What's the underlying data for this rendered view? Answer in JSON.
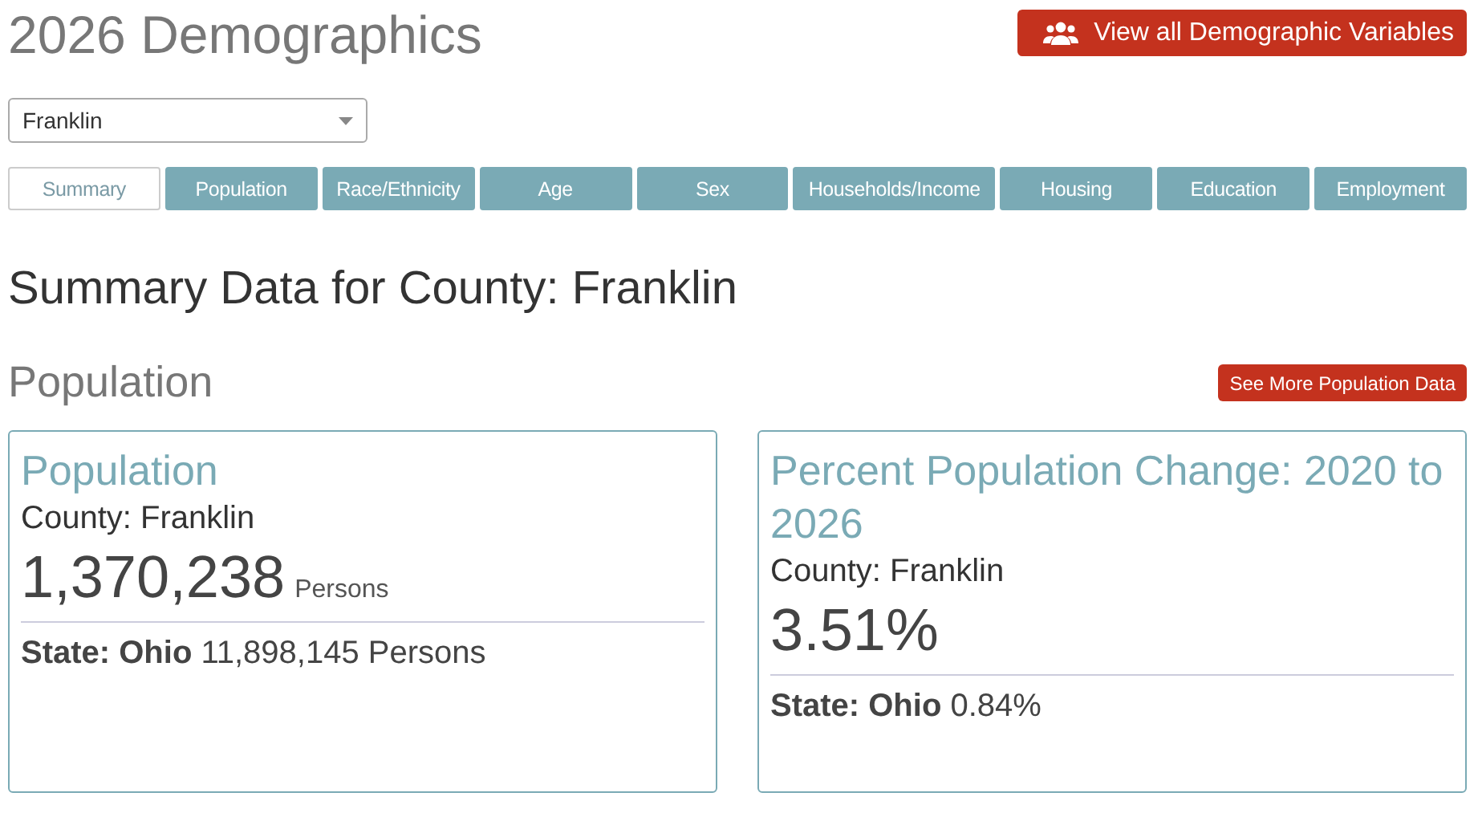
{
  "title": "2026 Demographics",
  "header_button": {
    "label": "View all Demographic Variables"
  },
  "county_select": {
    "value": "Franklin"
  },
  "tabs": [
    {
      "label": "Summary",
      "selected": true
    },
    {
      "label": "Population",
      "selected": false
    },
    {
      "label": "Race/Ethnicity",
      "selected": false
    },
    {
      "label": "Age",
      "selected": false
    },
    {
      "label": "Sex",
      "selected": false
    },
    {
      "label": "Households/Income",
      "selected": false
    },
    {
      "label": "Housing",
      "selected": false
    },
    {
      "label": "Education",
      "selected": false
    },
    {
      "label": "Employment",
      "selected": false
    }
  ],
  "heading": "Summary Data for County: Franklin",
  "section": {
    "title": "Population",
    "button": "See More Population Data",
    "cards": [
      {
        "title": "Population",
        "county": "County: Franklin",
        "value": "1,370,238",
        "unit": "Persons",
        "state": "**State: Ohio** 11,898,145 Persons"
      },
      {
        "title": "Percent Population Change: 2020 to 2026",
        "county": "County: Franklin",
        "value": "3.51%",
        "state": "**State: Ohio** 0.84%"
      }
    ]
  }
}
